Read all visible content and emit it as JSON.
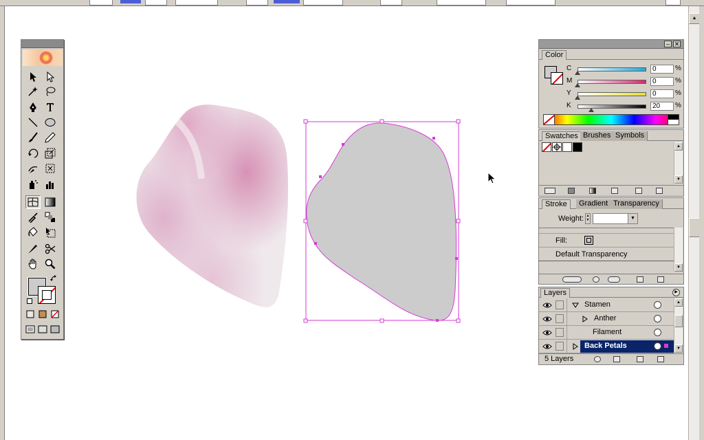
{
  "artboard": {
    "art_colors": {
      "petal_pink": "#d792b6",
      "petal_light": "#efe9ec",
      "selected_fill": "#cccccc",
      "selection_magenta": "#d63ad6"
    }
  },
  "toolbox": {
    "tools": [
      "selection",
      "direct-selection",
      "magic-wand",
      "lasso",
      "pen",
      "type",
      "line-segment",
      "ellipse",
      "paintbrush",
      "pencil",
      "rotate",
      "scale",
      "warp",
      "free-transform",
      "symbol-sprayer",
      "column-graph",
      "mesh",
      "gradient",
      "eyedropper",
      "blend",
      "live-paint-bucket",
      "live-paint-selection",
      "slice",
      "scissors",
      "hand",
      "zoom"
    ],
    "fill_color": "#cccccc",
    "stroke": "none"
  },
  "color_panel": {
    "tab_label": "Color",
    "sliders": [
      {
        "label": "C",
        "value": "0",
        "unit": "%",
        "colors": [
          "#ffffff",
          "#2aa6d6"
        ]
      },
      {
        "label": "M",
        "value": "0",
        "unit": "%",
        "colors": [
          "#ffffff",
          "#d6286e"
        ]
      },
      {
        "label": "Y",
        "value": "0",
        "unit": "%",
        "colors": [
          "#ffffff",
          "#e6e02a"
        ]
      },
      {
        "label": "K",
        "value": "20",
        "unit": "%",
        "colors": [
          "#ffffff",
          "#000000"
        ]
      }
    ]
  },
  "swatches_panel": {
    "tabs": [
      "Swatches",
      "Brushes",
      "Symbols"
    ],
    "active_tab": "Swatches"
  },
  "stroke_panel": {
    "tabs": [
      "Stroke",
      "Gradient",
      "Transparency"
    ],
    "active_tab": "Stroke",
    "weight_label": "Weight:",
    "weight_value": ""
  },
  "appearance_panel": {
    "fill_label": "Fill:",
    "default_transparency": "Default Transparency"
  },
  "layers_panel": {
    "tab_label": "Layers",
    "rows": [
      {
        "name": "Stamen",
        "disclosure": "expanded",
        "indent": 0,
        "selected": false
      },
      {
        "name": "Anther",
        "disclosure": "collapsed",
        "indent": 1,
        "selected": false
      },
      {
        "name": "Filament",
        "disclosure": "none",
        "indent": 1,
        "selected": false
      },
      {
        "name": "Back Petals",
        "disclosure": "collapsed",
        "indent": 0,
        "selected": true
      }
    ],
    "count_label": "5 Layers",
    "selection_color": "#0a246a"
  }
}
